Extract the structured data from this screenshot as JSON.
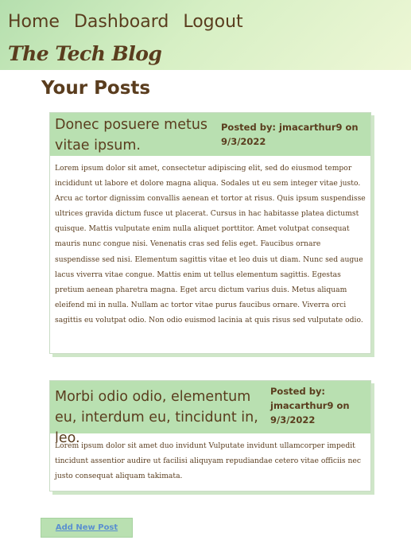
{
  "nav": {
    "home": "Home",
    "dashboard": "Dashboard",
    "logout": "Logout"
  },
  "brand": "The Tech Blog",
  "page_title": "Your Posts",
  "posts": [
    {
      "title": "Donec posuere metus vitae ipsum.",
      "meta_line1": "Posted by: jmacarthur9 on",
      "meta_line2": "9/3/2022",
      "meta_line3": "",
      "body": "Lorem ipsum dolor sit amet, consectetur adipiscing elit, sed do eiusmod tempor incididunt ut labore et dolore magna aliqua. Sodales ut eu sem integer vitae justo. Arcu ac tortor dignissim convallis aenean et tortor at risus. Quis ipsum suspendisse ultrices gravida dictum fusce ut placerat. Cursus in hac habitasse platea dictumst quisque. Mattis vulputate enim nulla aliquet porttitor. Amet volutpat consequat mauris nunc congue nisi. Venenatis cras sed felis eget. Faucibus ornare suspendisse sed nisi. Elementum sagittis vitae et leo duis ut diam. Nunc sed augue lacus viverra vitae congue. Mattis enim ut tellus elementum sagittis. Egestas pretium aenean pharetra magna. Eget arcu dictum varius duis. Metus aliquam eleifend mi in nulla. Nullam ac tortor vitae purus faucibus ornare. Viverra orci sagittis eu volutpat odio. Non odio euismod lacinia at quis risus sed vulputate odio."
    },
    {
      "title": "Morbi odio odio, elementum eu, interdum eu, tincidunt in, leo.",
      "meta_line1": "Posted by:",
      "meta_line2": "jmacarthur9 on",
      "meta_line3": "9/3/2022",
      "body": "Lorem ipsum dolor sit amet duo invidunt Vulputate invidunt ullamcorper impedit tincidunt assentior audire ut facilisi aliquyam repudiandae cetero vitae officiis nec justo consequat aliquam takimata."
    }
  ],
  "add_post_label": "Add New Post"
}
